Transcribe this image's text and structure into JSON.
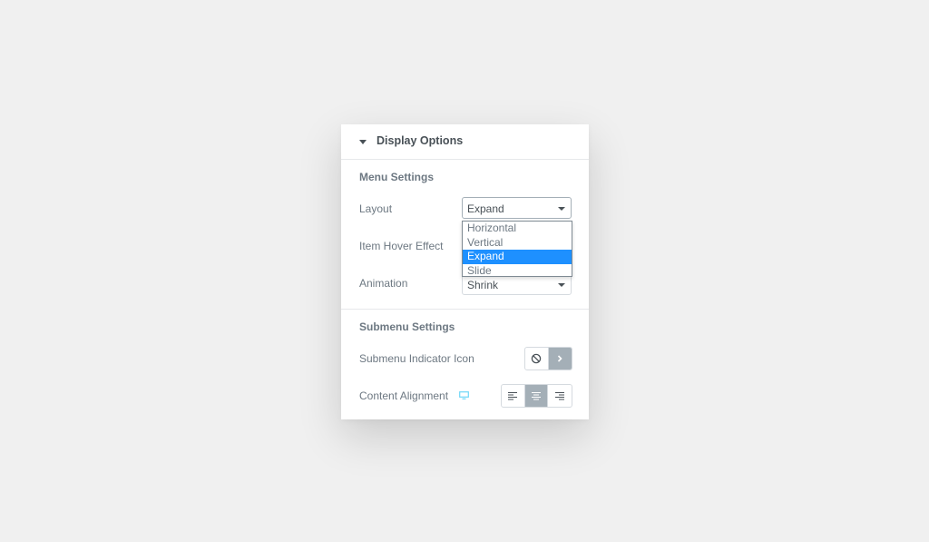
{
  "panel": {
    "section_title": "Display Options",
    "menu_settings": {
      "title": "Menu Settings",
      "layout": {
        "label": "Layout",
        "value": "Expand",
        "options": [
          "Horizontal",
          "Vertical",
          "Expand",
          "Slide"
        ],
        "selected_option": "Expand"
      },
      "hover_effect": {
        "label": "Item Hover Effect"
      },
      "animation": {
        "label": "Animation",
        "value": "Shrink"
      }
    },
    "submenu_settings": {
      "title": "Submenu Settings",
      "indicator": {
        "label": "Submenu Indicator Icon",
        "icons": [
          "ban-icon",
          "chevron-right-icon"
        ],
        "active": "chevron-right-icon"
      },
      "alignment": {
        "label": "Content Alignment",
        "device_icon": "desktop-icon",
        "icons": [
          "align-left-icon",
          "align-center-icon",
          "align-right-icon"
        ],
        "active": "align-center-icon"
      }
    }
  },
  "colors": {
    "background": "#f0f0f0",
    "panel": "#ffffff",
    "selected_option": "#1e90ff",
    "active_button": "#a4afb7",
    "responsive_icon": "#71d7f7"
  }
}
